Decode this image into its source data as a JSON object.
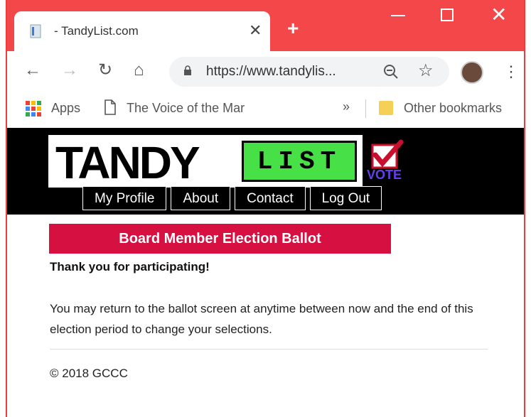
{
  "browser": {
    "tab_title": "- TandyList.com",
    "url": "https://www.tandylis...",
    "bookmarks": {
      "apps_label": "Apps",
      "voice_label": "The Voice of the Mar",
      "overflow_label": "»",
      "other_label": "Other bookmarks"
    },
    "accent_color": "#f4474a"
  },
  "site": {
    "logo": {
      "left": "TANDY",
      "right": "LIST",
      "badge": "VOTE"
    },
    "nav": [
      "My Profile",
      "About",
      "Contact",
      "Log Out"
    ]
  },
  "main": {
    "ballot_title": "Board Member Election Ballot",
    "thanks": "Thank you for participating!",
    "message": "You may return to the ballot screen at anytime between now and the end of this election period to change your selections.",
    "footer": "© 2018 GCCC",
    "ballot_color": "#d61141"
  }
}
